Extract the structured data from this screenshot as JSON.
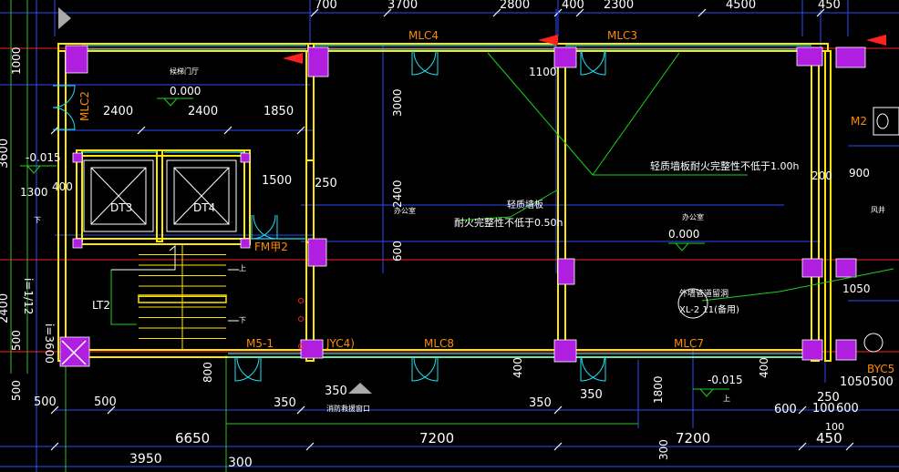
{
  "colors": {
    "background": "#000000",
    "wall": "#ffe600",
    "column": "#b01ee0",
    "window": "#22e0f0",
    "dimension": "#2a4dff",
    "text": "#ffffff",
    "door_text": "#ff8a00",
    "axis_red": "#ff2020",
    "green_line": "#19d419",
    "axis_green": "#30c030"
  },
  "dims_top": [
    "700",
    "3700",
    "2800",
    "400",
    "2300",
    "4500",
    "450"
  ],
  "dims_left": [
    "1000",
    "400",
    "1300",
    "500",
    "500"
  ],
  "dims_left_rot": [
    "3600",
    "2400",
    "i=3600",
    "i=1/12"
  ],
  "dims_interior": [
    "2400",
    "2400",
    "1850",
    "1500",
    "250",
    "1100",
    "900",
    "200",
    "1050"
  ],
  "dims_vertical": [
    "3000",
    "2400",
    "600",
    "400",
    "1800",
    "400",
    "300",
    "800"
  ],
  "dims_bottom_small": [
    "500",
    "500",
    "350",
    "350",
    "350",
    "350",
    "600",
    "100",
    "600",
    "250",
    "1050",
    "500"
  ],
  "dims_bottom_large": [
    "6650",
    "7200",
    "7200",
    "450",
    "3950",
    "300",
    "100"
  ],
  "levels": [
    "0.000",
    "-0.015",
    "0.000",
    "-0.015"
  ],
  "door_labels": [
    "MLC4",
    "MLC3",
    "MLC2",
    "MLC8",
    "MLC7",
    "M5-1",
    "JYC4)",
    "FM甲2",
    "M2",
    "BYC5"
  ],
  "elevators": [
    "DT3",
    "DT4"
  ],
  "stair_label": "LT2",
  "annotations": {
    "fire_wall_1": "轻质墙板耐火完整性不低于1.00h",
    "fire_wall_2a": "轻质墙板",
    "fire_wall_2b": "耐火完整性不低于0.50h",
    "pipe_note_a": "外墙管道留洞",
    "pipe_note_b": "XL-2  11(备用)"
  },
  "small_texts": [
    "候梯门厅",
    "办公室",
    "办公室",
    "风井",
    "消防救援窗口",
    "下",
    "下",
    "上",
    "上"
  ]
}
